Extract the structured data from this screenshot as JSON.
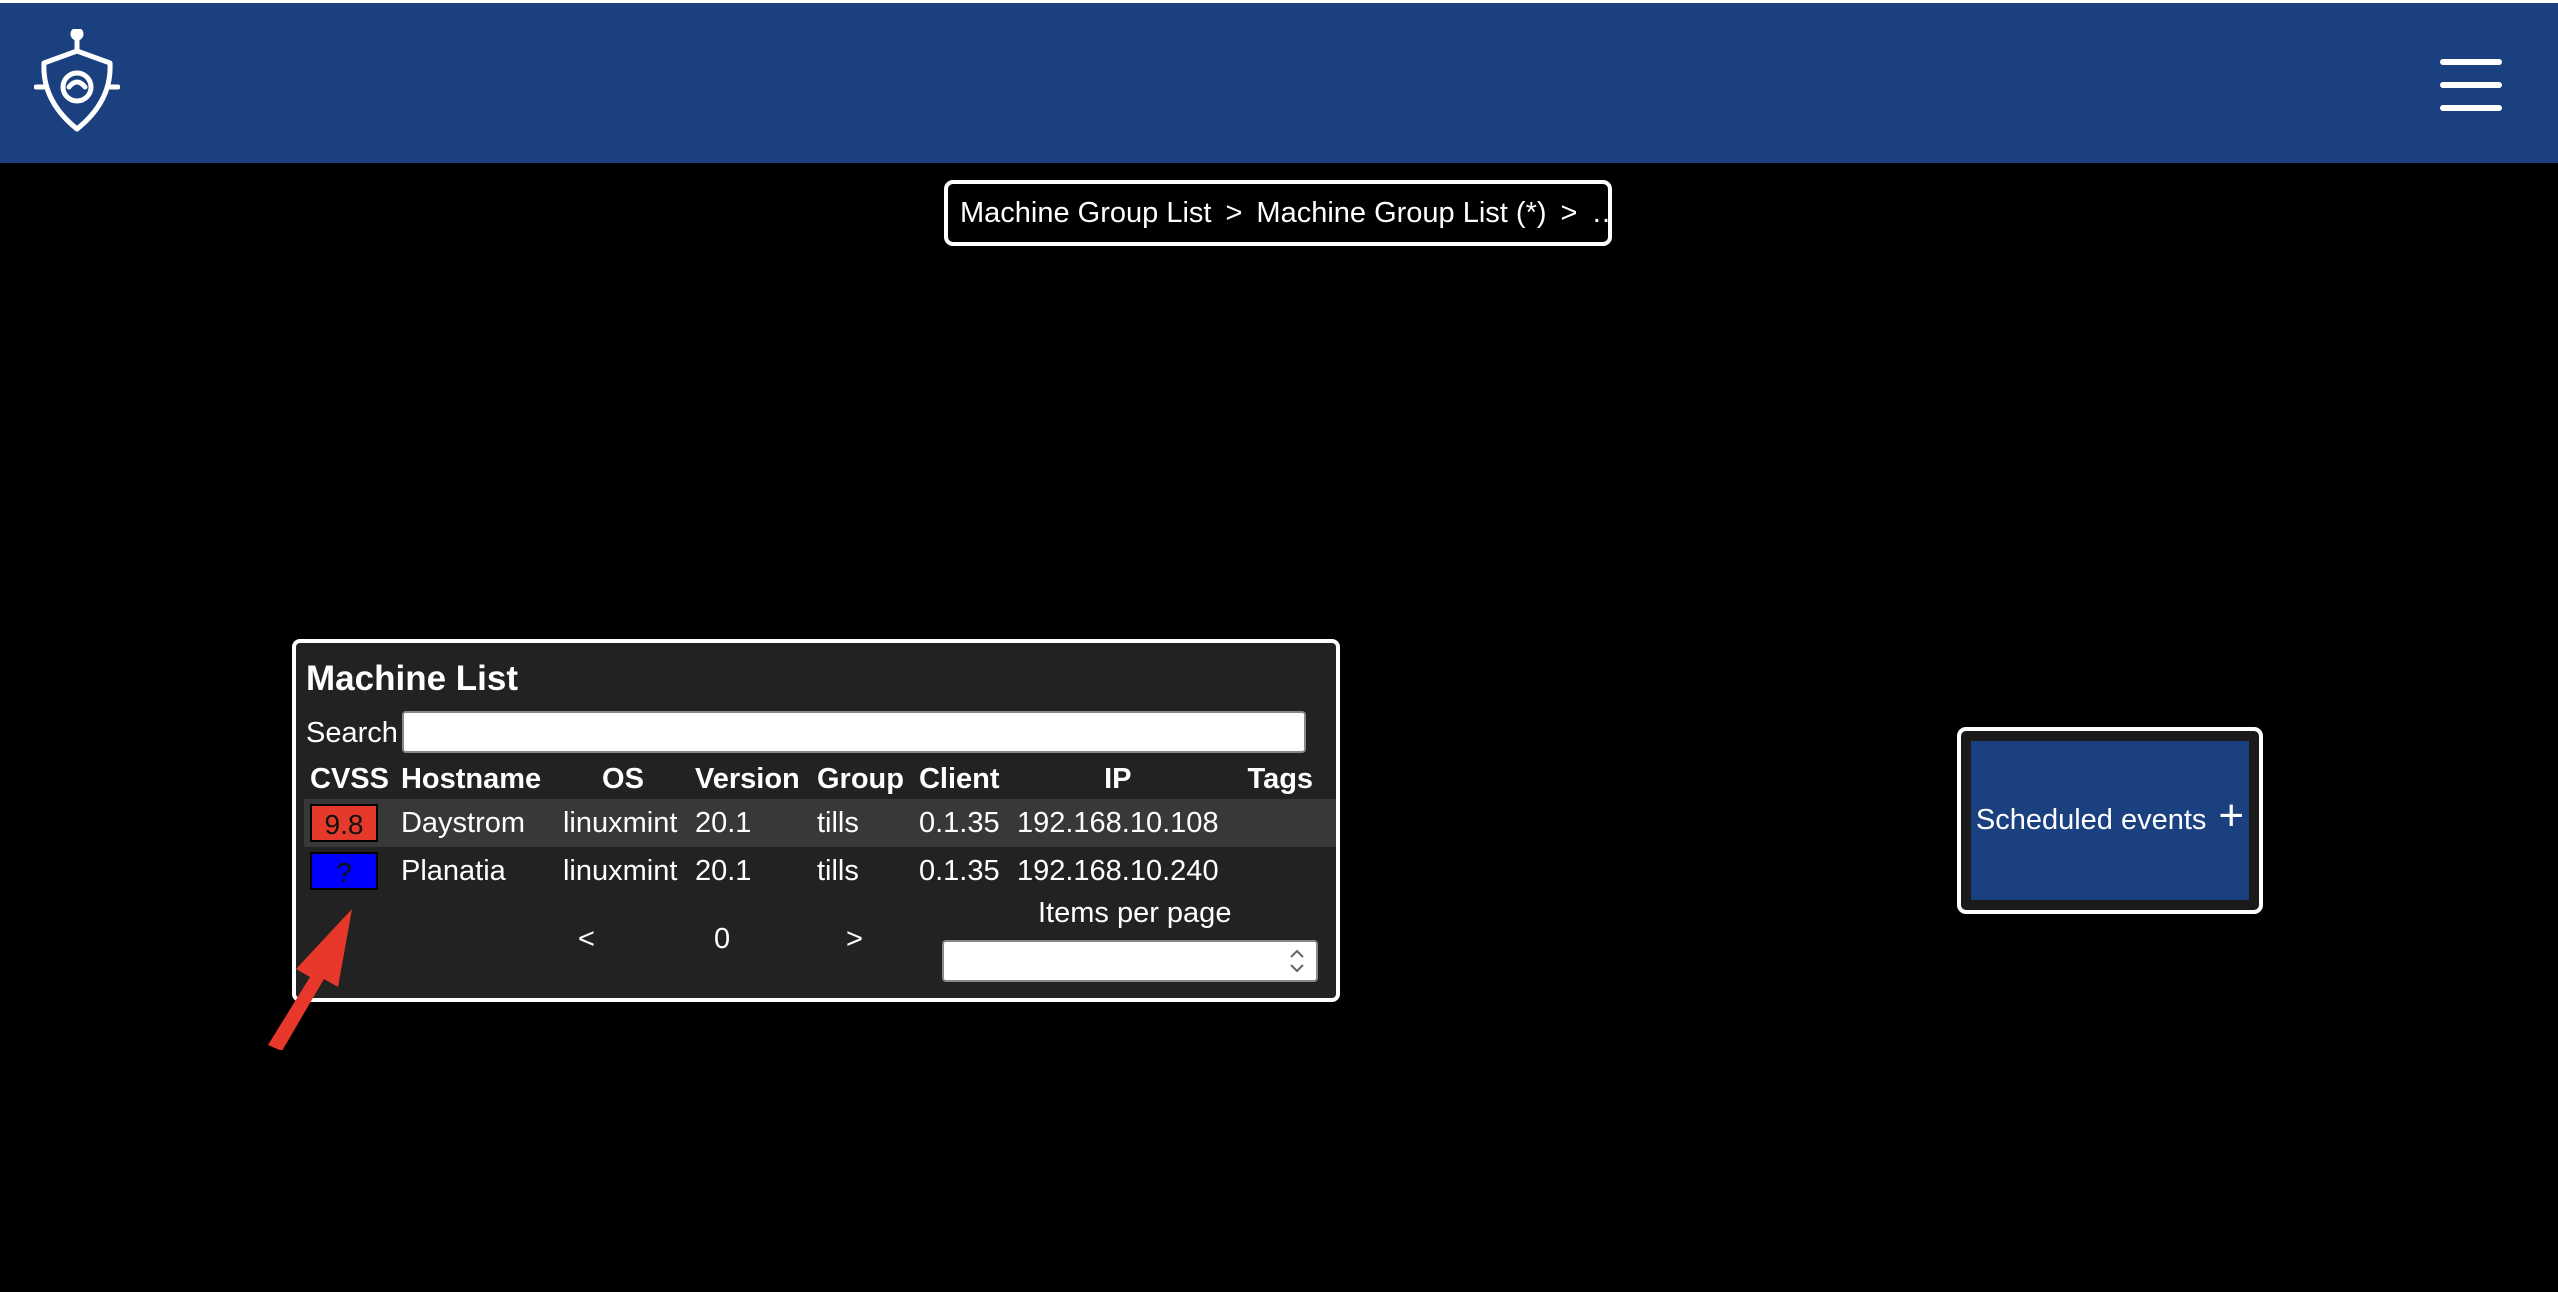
{
  "header": {
    "logo_icon": "shield-robot-logo-icon",
    "menu_icon": "hamburger-menu-icon",
    "color": "#1a4080"
  },
  "breadcrumb": {
    "items": [
      "Machine Group List",
      "Machine Group List (*)",
      "…"
    ],
    "separator": ">"
  },
  "machine_list": {
    "title": "Machine List",
    "search_label": "Search",
    "search_value": "",
    "columns": [
      "CVSS",
      "Hostname",
      "OS",
      "Version",
      "Group",
      "Client",
      "IP",
      "Tags"
    ],
    "rows": [
      {
        "cvss": "9.8",
        "cvss_color": "#e53a2a",
        "hostname": "Daystrom",
        "os": "linuxmint",
        "version": "20.1",
        "group": "tills",
        "client": "0.1.35",
        "ip": "192.168.10.108",
        "tags": ""
      },
      {
        "cvss": "?",
        "cvss_color": "#0000ff",
        "hostname": "Planatia",
        "os": "linuxmint",
        "version": "20.1",
        "group": "tills",
        "client": "0.1.35",
        "ip": "192.168.10.240",
        "tags": ""
      }
    ],
    "pager": {
      "prev": "<",
      "page": "0",
      "next": ">"
    },
    "items_per_page_label": "Items per page",
    "items_per_page_value": ""
  },
  "scheduled_events": {
    "label": "Scheduled events",
    "plus": "+"
  },
  "annotation": {
    "arrow_color": "#e8372b"
  }
}
